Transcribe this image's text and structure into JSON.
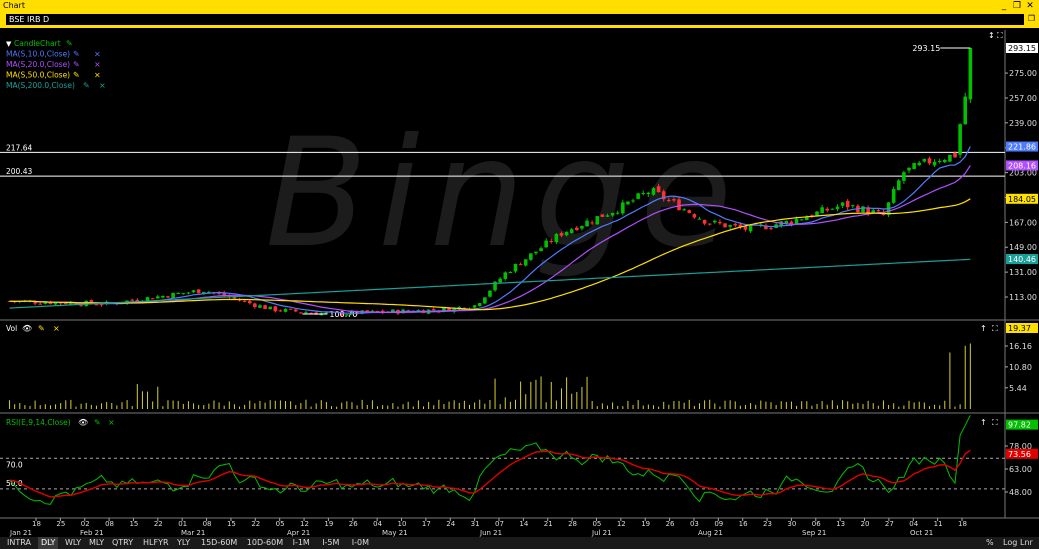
{
  "window": {
    "title": "Chart"
  },
  "chart_header": {
    "symbol": "BSE IRB D"
  },
  "legend": [
    {
      "label": "CandleChart",
      "color": "#00c000"
    },
    {
      "label": "MA(S,10.0,Close)",
      "color": "#4f7bff"
    },
    {
      "label": "MA(S,20.0,Close)",
      "color": "#b050ff"
    },
    {
      "label": "MA(S,50.0,Close)",
      "color": "#ffe000"
    },
    {
      "label": "MA(S,200.0,Close)",
      "color": "#1aa09a"
    }
  ],
  "volume_label": "Vol",
  "rsi_label": "RSI(E,9,14,Close)",
  "levels": {
    "upper": "217.64",
    "lower": "200.43"
  },
  "annotations": {
    "high": "293.15",
    "low": "100.70"
  },
  "right_badges": {
    "ma10": "221.86",
    "ma20": "208.16",
    "ma50": "184.05",
    "ma200": "140.46",
    "volume": "19.37",
    "rsi_fast": "97.82",
    "rsi_slow": "73.56"
  },
  "price_axis": [
    "293.15",
    "275.00",
    "257.00",
    "239.00",
    "221.00",
    "203.00",
    "185.00",
    "167.00",
    "149.00",
    "131.00",
    "113.00"
  ],
  "volume_axis": [
    "16.16",
    "10.80",
    "5.44"
  ],
  "rsi_axis": [
    "78.00",
    "63.00",
    "48.00"
  ],
  "rsi_levels": [
    "70.0",
    "50.0"
  ],
  "date_axis": {
    "days": [
      "18",
      "25",
      "02",
      "08",
      "15",
      "22",
      "01",
      "08",
      "15",
      "22",
      "05",
      "12",
      "19",
      "26",
      "04",
      "10",
      "17",
      "24",
      "31",
      "07",
      "14",
      "21",
      "28",
      "05",
      "12",
      "19",
      "26",
      "03",
      "09",
      "16",
      "23",
      "30",
      "06",
      "13",
      "20",
      "27",
      "04",
      "11",
      "18"
    ],
    "months": [
      "Jan 21",
      "Feb 21",
      "Mar 21",
      "Apr 21",
      "May 21",
      "Jun 21",
      "Jul 21",
      "Aug 21",
      "Sep 21",
      "Oct 21"
    ]
  },
  "bottom_bar": {
    "intervals": [
      "INTRA",
      "DLY",
      "WLY",
      "MLY",
      "QTRY",
      "HLFYR",
      "YLY"
    ],
    "active": "DLY",
    "intraday": [
      "15D-60M",
      "10D-60M",
      "I-1M",
      "I-5M",
      "I-0M"
    ],
    "right": [
      "%",
      "Log",
      "Lnr"
    ]
  },
  "watermark": "Binge",
  "chart_data": {
    "type": "candlestick",
    "title": "BSE IRB D",
    "x_range": [
      "2021-01-15",
      "2021-10-21"
    ],
    "ylim": [
      100,
      300
    ],
    "price_close_approx": [
      {
        "date": "2021-01-15",
        "close": 110
      },
      {
        "date": "2021-02-01",
        "close": 108
      },
      {
        "date": "2021-03-05",
        "close": 118
      },
      {
        "date": "2021-04-01",
        "close": 104
      },
      {
        "date": "2021-04-19",
        "close": 100.7
      },
      {
        "date": "2021-05-20",
        "close": 104
      },
      {
        "date": "2021-06-03",
        "close": 130
      },
      {
        "date": "2021-06-21",
        "close": 160
      },
      {
        "date": "2021-07-07",
        "close": 178
      },
      {
        "date": "2021-07-15",
        "close": 190
      },
      {
        "date": "2021-08-03",
        "close": 167
      },
      {
        "date": "2021-08-20",
        "close": 165
      },
      {
        "date": "2021-09-15",
        "close": 180
      },
      {
        "date": "2021-09-28",
        "close": 208
      },
      {
        "date": "2021-10-12",
        "close": 214
      },
      {
        "date": "2021-10-18",
        "close": 218
      },
      {
        "date": "2021-10-21",
        "close": 293.15
      }
    ],
    "horizontal_levels": [
      217.64,
      200.43
    ],
    "ma_last": {
      "ma10": 221.86,
      "ma20": 208.16,
      "ma50": 184.05,
      "ma200": 140.46
    },
    "volume_last": 19.37,
    "rsi_last": {
      "fast": 97.82,
      "slow": 73.56
    },
    "rsi_bands": [
      70,
      50
    ]
  }
}
